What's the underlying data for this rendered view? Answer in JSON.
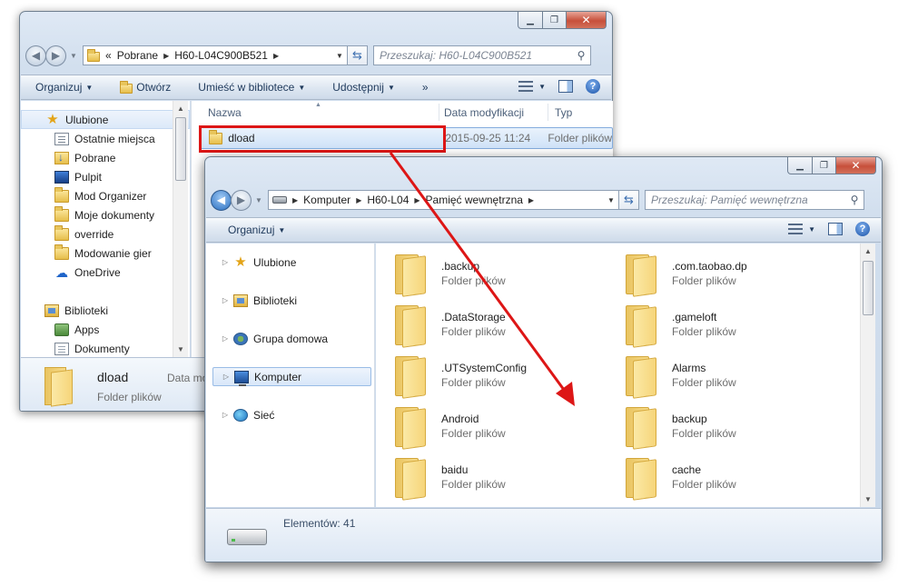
{
  "colors": {
    "accent": "#1e395b",
    "callout": "#dd1616",
    "selection": "#cfe2f8"
  },
  "win1": {
    "caption_buttons": [
      "minimize-icon",
      "maximize-icon",
      "close-icon"
    ],
    "address": {
      "chevron": "«",
      "crumbs": [
        "Pobrane",
        "H60-L04C900B521"
      ]
    },
    "search_placeholder": "Przeszukaj: H60-L04C900B521",
    "toolbar": {
      "organize": "Organizuj",
      "open": "Otwórz",
      "include": "Umieść w bibliotece",
      "share": "Udostępnij",
      "more": "»"
    },
    "nav": {
      "favorites": "Ulubione",
      "favorite_items": [
        "Ostatnie miejsca",
        "Pobrane",
        "Pulpit",
        "Mod Organizer",
        "Moje dokumenty",
        "override",
        "Modowanie gier",
        "OneDrive"
      ],
      "libraries": "Biblioteki",
      "library_items": [
        "Apps",
        "Dokumenty"
      ]
    },
    "columns": {
      "name": "Nazwa",
      "date": "Data modyfikacji",
      "type": "Typ"
    },
    "rows": [
      {
        "name": "dload",
        "date": "2015-09-25 11:24",
        "type": "Folder plików"
      }
    ],
    "details": {
      "name": "dload",
      "type": "Folder plików",
      "date_label": "Data mo"
    }
  },
  "win2": {
    "caption_buttons": [
      "minimize-icon",
      "maximize-icon",
      "close-icon"
    ],
    "address": {
      "crumbs": [
        "Komputer",
        "H60-L04",
        "Pamięć wewnętrzna"
      ]
    },
    "search_placeholder": "Przeszukaj: Pamięć wewnętrzna",
    "toolbar": {
      "organize": "Organizuj"
    },
    "nav": [
      "Ulubione",
      "Biblioteki",
      "Grupa domowa",
      "Komputer",
      "Sieć"
    ],
    "nav_selected": "Komputer",
    "items": [
      {
        "name": ".backup",
        "type": "Folder plików"
      },
      {
        "name": ".com.taobao.dp",
        "type": "Folder plików"
      },
      {
        "name": ".DataStorage",
        "type": "Folder plików"
      },
      {
        "name": ".gameloft",
        "type": "Folder plików"
      },
      {
        "name": ".UTSystemConfig",
        "type": "Folder plików"
      },
      {
        "name": "Alarms",
        "type": "Folder plików"
      },
      {
        "name": "Android",
        "type": "Folder plików"
      },
      {
        "name": "backup",
        "type": "Folder plików"
      },
      {
        "name": "baidu",
        "type": "Folder plików"
      },
      {
        "name": "cache",
        "type": "Folder plików"
      }
    ],
    "status": "Elementów: 41"
  }
}
